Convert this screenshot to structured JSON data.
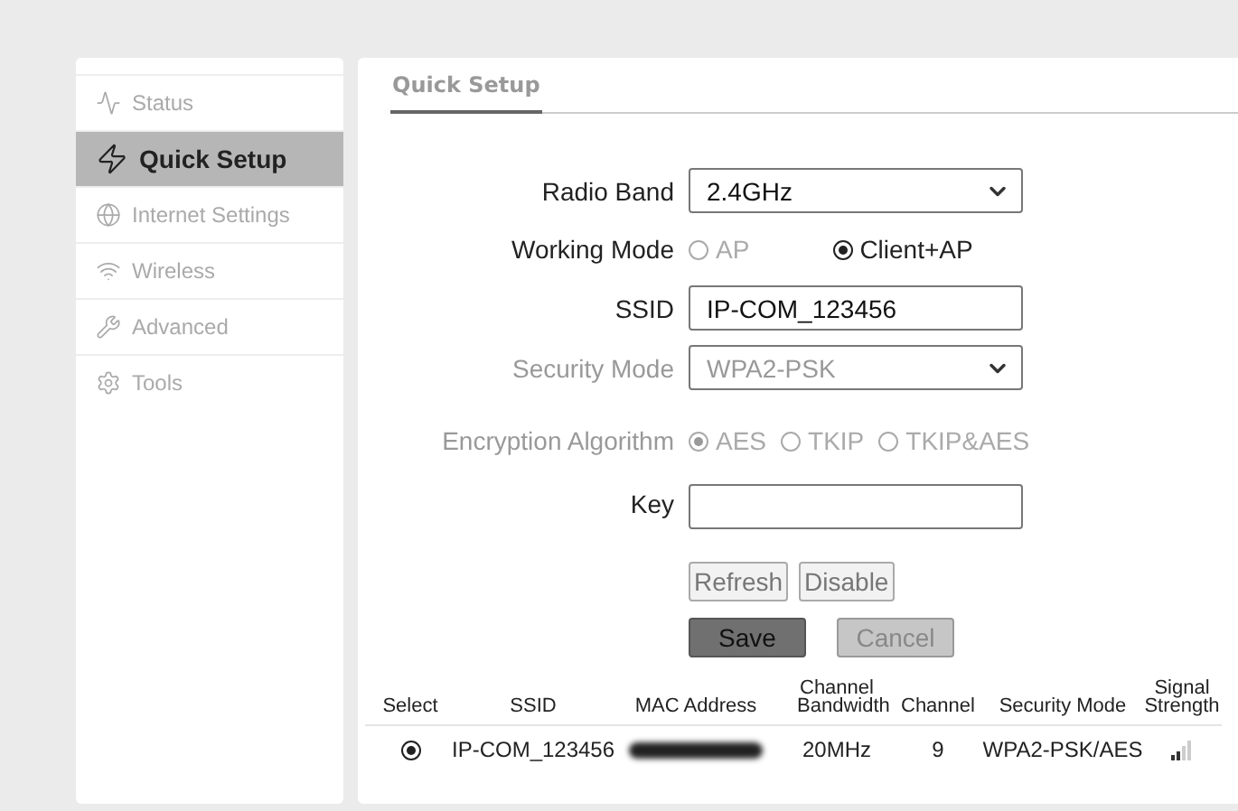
{
  "sidebar": {
    "items": [
      {
        "label": "Status",
        "selected": false
      },
      {
        "label": "Quick Setup",
        "selected": true
      },
      {
        "label": "Internet Settings",
        "selected": false
      },
      {
        "label": "Wireless",
        "selected": false
      },
      {
        "label": "Advanced",
        "selected": false
      },
      {
        "label": "Tools",
        "selected": false
      }
    ]
  },
  "main": {
    "title": "Quick Setup",
    "form": [
      {
        "kind": "select",
        "label": "Radio Band",
        "value": "2.4GHz",
        "disabled": false
      },
      {
        "kind": "radio",
        "label": "Working Mode",
        "disabled": false,
        "options": [
          {
            "label": "AP",
            "selected": false,
            "disabled": true
          },
          {
            "label": "Client+AP",
            "selected": true,
            "disabled": false
          }
        ]
      },
      {
        "kind": "input",
        "label": "SSID",
        "value": "IP-COM_123456",
        "disabled": false
      },
      {
        "kind": "select",
        "label": "Security Mode",
        "value": "WPA2-PSK",
        "disabled": true
      },
      {
        "kind": "radio",
        "label": "Encryption Algorithm",
        "disabled": true,
        "options": [
          {
            "label": "AES",
            "selected": true,
            "disabled": true
          },
          {
            "label": "TKIP",
            "selected": false,
            "disabled": true
          },
          {
            "label": "TKIP&AES",
            "selected": false,
            "disabled": true
          }
        ]
      },
      {
        "kind": "input",
        "label": "Key",
        "disabled": false
      }
    ],
    "button_rows": [
      [
        {
          "label": "Refresh",
          "kind": "small"
        },
        {
          "label": "Disable",
          "kind": "small"
        }
      ],
      [
        {
          "label": "Save",
          "kind": "primary",
          "disabled": false
        },
        {
          "label": "Cancel",
          "kind": "primary",
          "disabled": true
        }
      ]
    ],
    "table": {
      "columns": [
        "Select",
        "SSID",
        "MAC Address",
        "Channel Bandwidth",
        "Channel",
        "Security Mode",
        "Signal Strength"
      ],
      "rows": [
        {
          "selected": true,
          "ssid": "IP-COM_123456",
          "mac": {
            "kind": "redacted"
          },
          "bandwidth": "20MHz",
          "channel": "9",
          "security": "WPA2-PSK/AES"
        }
      ]
    }
  }
}
